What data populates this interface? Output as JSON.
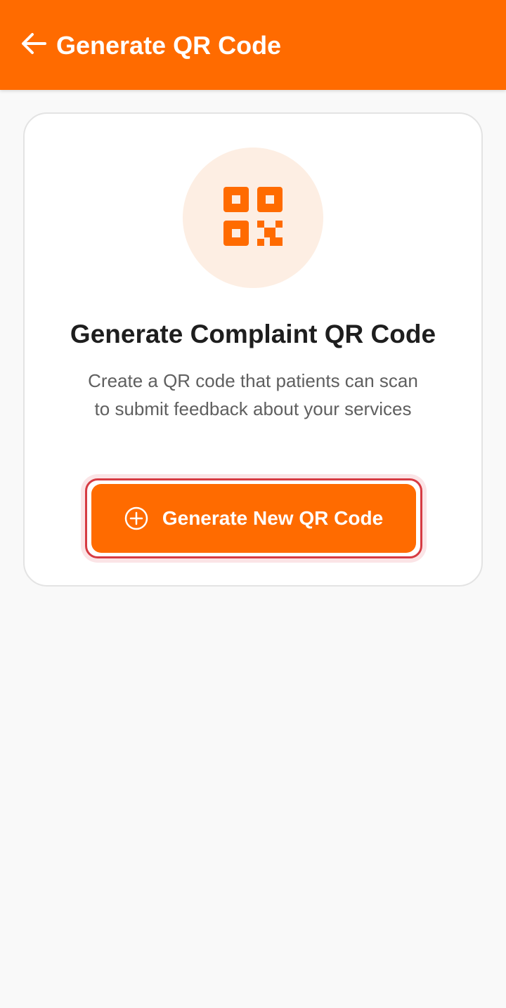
{
  "header": {
    "title": "Generate QR Code",
    "back_icon": "arrow-left-icon",
    "background_color": "#ff6b00"
  },
  "card": {
    "icon": "qr-code-icon",
    "title": "Generate Complaint QR Code",
    "description": "Create a QR code that patients can scan to submit feedback about your services",
    "button": {
      "label": "Generate New QR Code",
      "icon": "plus-circle-icon"
    }
  },
  "colors": {
    "accent": "#ff6b00",
    "icon_bg": "#fdeee3",
    "focus_border": "#d63b43",
    "page_bg": "#f9f9f9"
  }
}
